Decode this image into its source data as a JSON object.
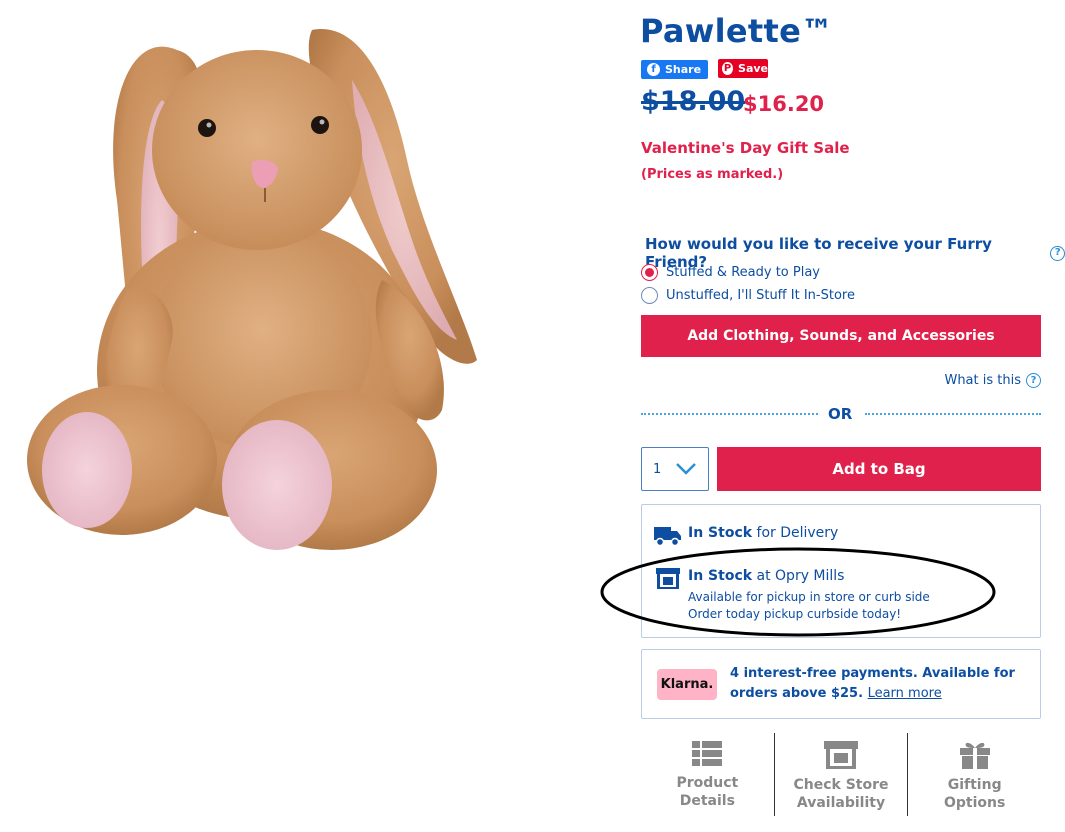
{
  "product": {
    "title": "Pawlette™",
    "image_name": "plush-bunny"
  },
  "social": {
    "share_label": "Share",
    "save_label": "Save"
  },
  "price": {
    "original": "$18.00",
    "sale": "$16.20",
    "sale_label": "Valentine's Day Gift Sale",
    "sale_note": "(Prices as marked.)"
  },
  "receive": {
    "question": "How would you like to receive your Furry Friend?",
    "options": [
      {
        "label": "Stuffed & Ready to Play",
        "selected": true
      },
      {
        "label": "Unstuffed, I'll Stuff It In-Store",
        "selected": false
      }
    ]
  },
  "actions": {
    "accessories_label": "Add Clothing, Sounds, and Accessories",
    "what_is_this": "What is this",
    "or_label": "OR",
    "quantity": "1",
    "add_to_bag": "Add to Bag"
  },
  "stock": {
    "delivery_status": "In Stock",
    "delivery_suffix": "for Delivery",
    "store_status": "In Stock",
    "store_suffix": "at Opry Mills",
    "store_line1": "Available for pickup in store or curb side",
    "store_line2": "Order today pickup curbside today!"
  },
  "klarna": {
    "badge": "Klarna.",
    "text": "4 interest-free payments. Available for orders above $25.",
    "link": "Learn more"
  },
  "tabs": [
    {
      "label": "Product Details",
      "icon": "list-icon"
    },
    {
      "label": "Check Store Availability",
      "icon": "store-icon"
    },
    {
      "label": "Gifting Options",
      "icon": "gift-icon"
    }
  ],
  "colors": {
    "brand_blue": "#0d4ea1",
    "accent_red": "#e0214b"
  }
}
